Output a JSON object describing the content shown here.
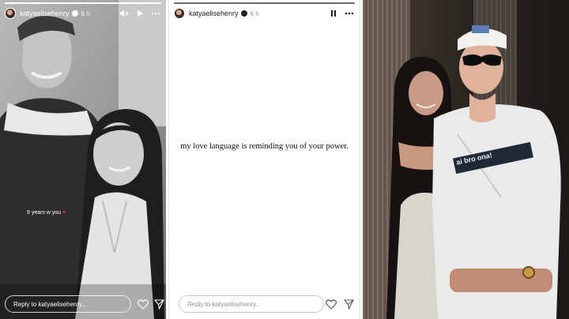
{
  "stories": [
    {
      "username": "katyaelisehenry",
      "time": "6 h",
      "progress": 1.0,
      "caption": "9 years w you",
      "caption_heart": "♥",
      "reply_placeholder": "Reply to katyaelisehenry...",
      "header_icons": [
        "volume-muted-icon",
        "play-icon",
        "more-icon"
      ]
    },
    {
      "username": "katyaelisehenry",
      "time": "6 h",
      "progress": 1.0,
      "text": "my love language is reminding you of your power.",
      "reply_placeholder": "Reply to katyaelisehenry...",
      "header_icons": [
        "pause-icon",
        "more-icon"
      ]
    },
    {
      "shirt_text": "ai bro ona!"
    }
  ],
  "colors": {
    "heart": "#d7263d",
    "dark_text": "#222222",
    "muted_text": "#8e8e8e"
  }
}
